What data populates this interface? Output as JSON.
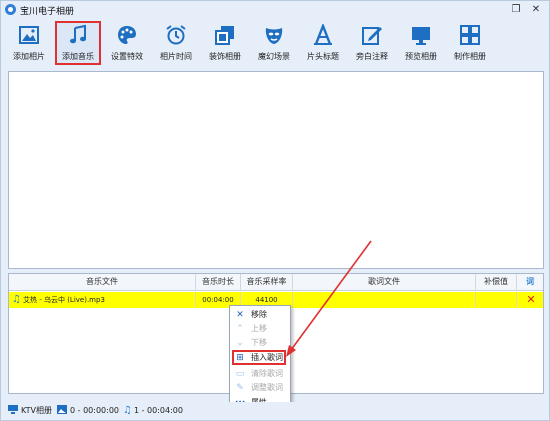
{
  "window": {
    "title": "宝川电子相册",
    "restore_glyph": "❐",
    "close_glyph": "✕"
  },
  "toolbar": {
    "items": [
      {
        "label": "添加相片",
        "icon": "photo-icon"
      },
      {
        "label": "添加音乐",
        "icon": "music-note-icon",
        "active": true
      },
      {
        "label": "设置特效",
        "icon": "palette-icon"
      },
      {
        "label": "相片时间",
        "icon": "alarm-clock-icon"
      },
      {
        "label": "装饰相册",
        "icon": "decorate-icon"
      },
      {
        "label": "魔幻场景",
        "icon": "mask-icon"
      },
      {
        "label": "片头标题",
        "icon": "title-a-icon"
      },
      {
        "label": "旁白注释",
        "icon": "edit-icon"
      },
      {
        "label": "预览相册",
        "icon": "monitor-icon"
      },
      {
        "label": "制作相册",
        "icon": "grid-icon"
      }
    ]
  },
  "music_table": {
    "headers": [
      "音乐文件",
      "音乐时长",
      "音乐采样率",
      "歌词文件",
      "补偿值",
      "词"
    ],
    "rows": [
      {
        "file": "艾热 - 乌云中 (Live).mp3",
        "duration": "00:04:00",
        "sample_rate": "44100",
        "lyrics": "",
        "offset": "",
        "delete_glyph": "✕"
      }
    ]
  },
  "context_menu": {
    "items": [
      {
        "label": "移除",
        "icon": "x-icon",
        "glyph": "✕",
        "enabled": true
      },
      {
        "label": "上移",
        "icon": "up-arrow-icon",
        "glyph": "⌃",
        "enabled": false
      },
      {
        "label": "下移",
        "icon": "down-arrow-icon",
        "glyph": "⌄",
        "enabled": false
      },
      {
        "label": "插入歌词",
        "icon": "insert-lyrics-icon",
        "glyph": "⊞",
        "enabled": true,
        "highlighted": true
      },
      {
        "label": "清除歌词",
        "icon": "clear-lyrics-icon",
        "glyph": "▭",
        "enabled": false
      },
      {
        "label": "调整歌词",
        "icon": "adjust-lyrics-icon",
        "glyph": "✎",
        "enabled": false
      },
      {
        "label": "属性",
        "icon": "more-icon",
        "glyph": "···",
        "enabled": true
      }
    ]
  },
  "status": {
    "ktv_label": "KTV相册",
    "photos": "0 - 00:00:00",
    "music": "1 - 00:04:00"
  },
  "colors": {
    "accent": "#2f7fd8",
    "highlight": "#e03030",
    "row_bg": "#ffff00",
    "app_bg": "#e6eef9"
  }
}
